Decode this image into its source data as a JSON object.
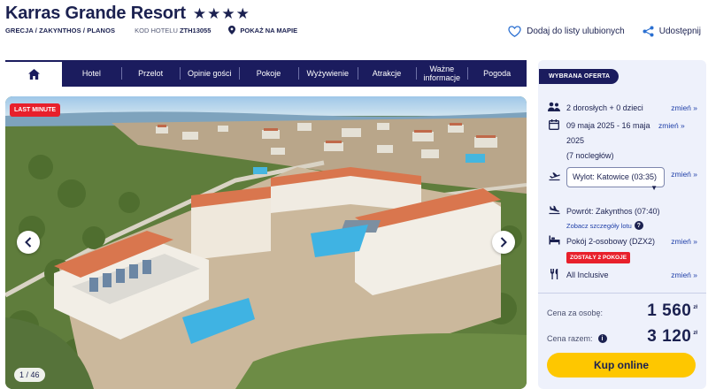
{
  "hotel": {
    "name": "Karras Grande Resort",
    "stars": "★★★★",
    "location": "GRECJA / ZAKYNTHOS / PLANOS",
    "code_label": "KOD HOTELU",
    "code_value": "ZTH13055",
    "map_link": "POKAŻ NA MAPIE"
  },
  "actions": {
    "favorite": "Dodaj do listy ulubionych",
    "share": "Udostępnij"
  },
  "nav": {
    "items": [
      "Hotel",
      "Przelot",
      "Opinie gości",
      "Pokoje",
      "Wyżywienie",
      "Atrakcje",
      "Ważne informacje",
      "Pogoda"
    ]
  },
  "gallery": {
    "badge": "LAST MINUTE",
    "counter": "1 / 46"
  },
  "offer": {
    "tag": "WYBRANA OFERTA",
    "change_label": "zmień »",
    "travelers": "2 dorosłych + 0 dzieci",
    "dates": "09 maja 2025 - 16 maja 2025",
    "nights": "(7 nocległów)",
    "departure": "Wylot: Katowice (03:35)",
    "return_flight": "Powrót: Zakynthos (07:40)",
    "flight_details_link": "Zobacz szczegóły lotu",
    "room": "Pokój 2-osobowy (DZX2)",
    "rooms_left": "ZOSTAŁY 2 POKOJE",
    "board": "All Inclusive"
  },
  "price": {
    "per_person_label": "Cena za osobę:",
    "per_person_value": "1 560",
    "total_label": "Cena razem:",
    "total_value": "3 120",
    "currency": "zł"
  },
  "cta": {
    "label": "Kup online"
  },
  "colors": {
    "navy": "#1b1c5e",
    "accent_red": "#e8202b",
    "cta_yellow": "#fec700",
    "panel_bg": "#eef1fb",
    "link_blue": "#1f3fa8"
  }
}
